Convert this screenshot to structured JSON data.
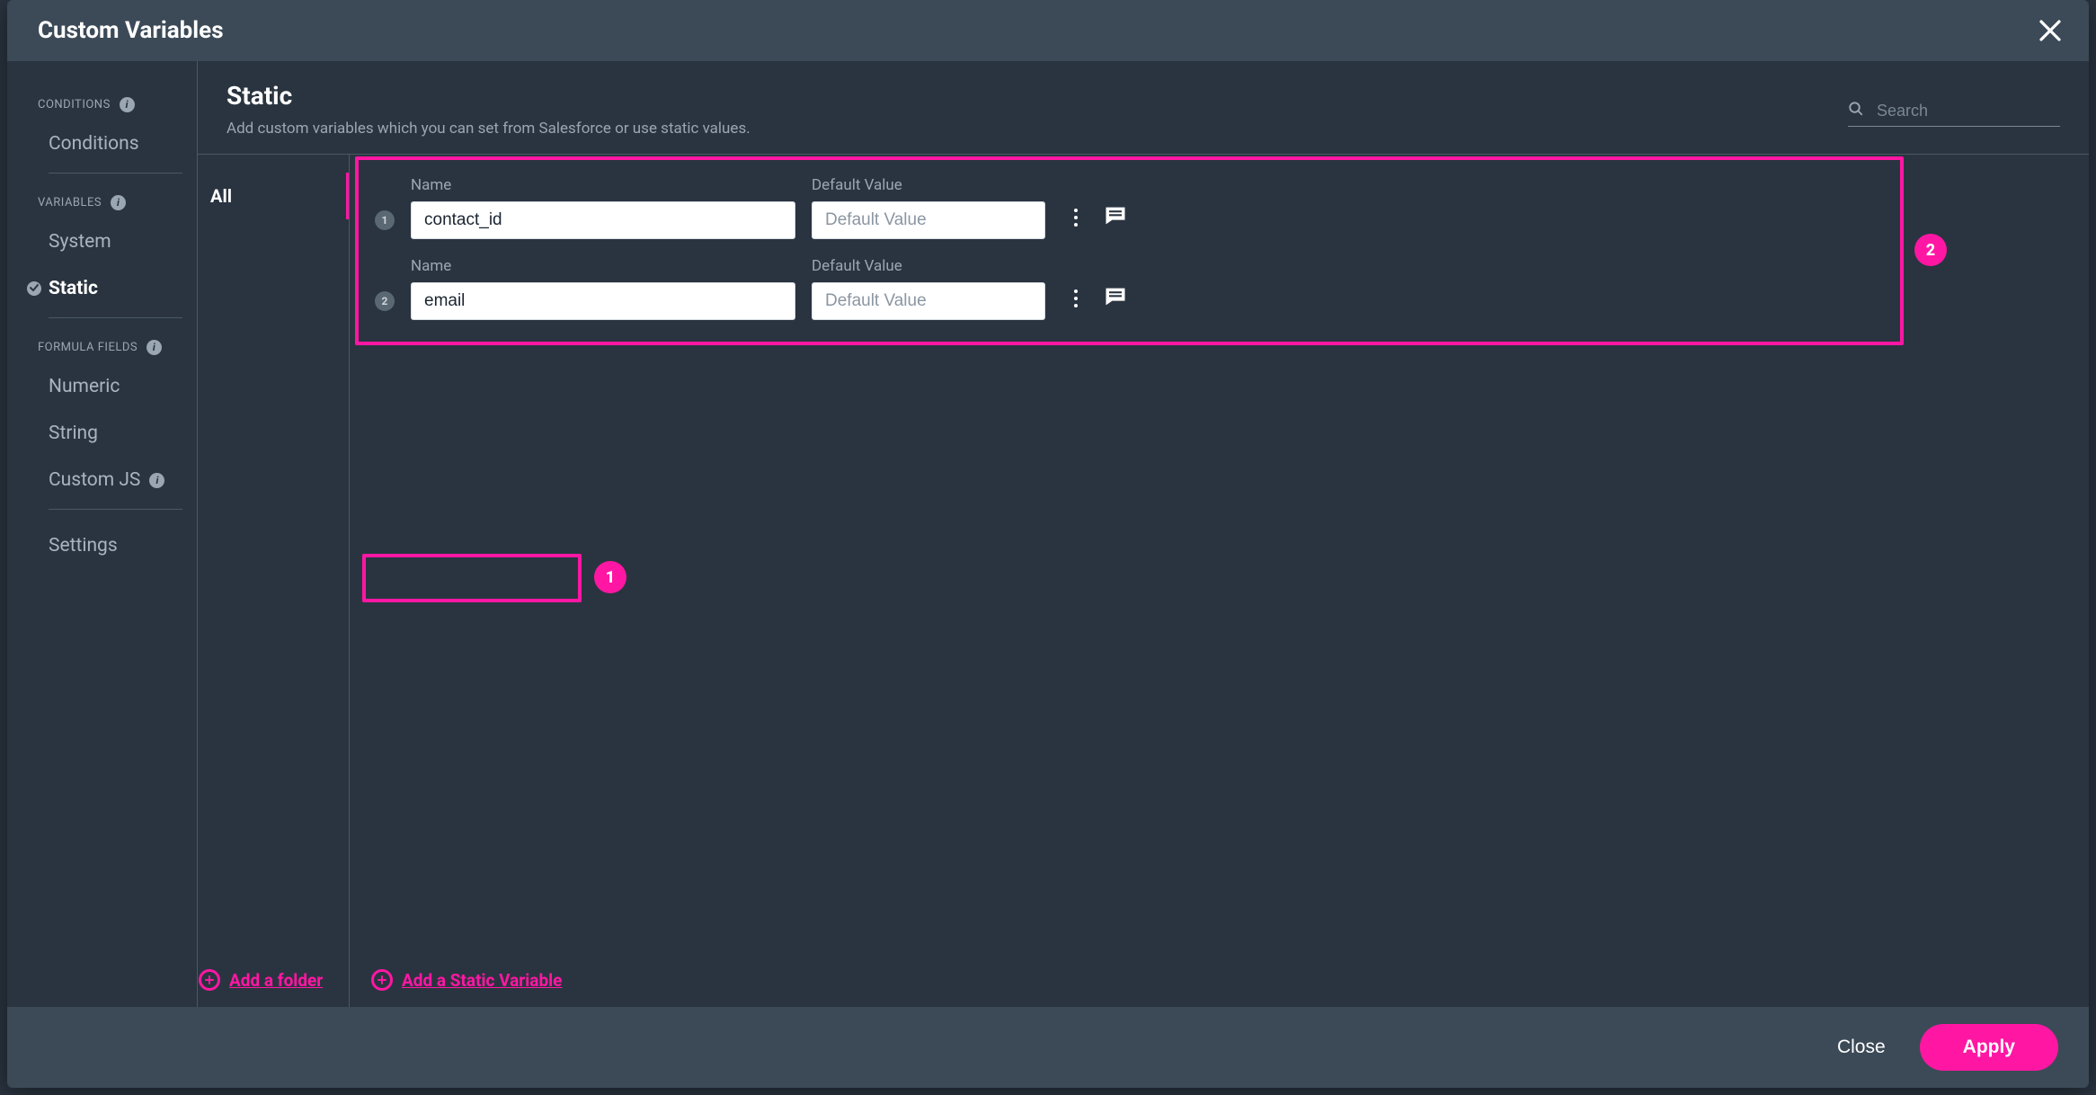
{
  "header": {
    "title": "Custom Variables"
  },
  "sidebar": {
    "sections": [
      {
        "title": "CONDITIONS",
        "has_info": true
      },
      {
        "title": "VARIABLES",
        "has_info": true
      },
      {
        "title": "FORMULA FIELDS",
        "has_info": true
      }
    ],
    "items": {
      "conditions": "Conditions",
      "system": "System",
      "static": "Static",
      "numeric": "Numeric",
      "string": "String",
      "customjs": "Custom JS",
      "settings": "Settings"
    },
    "active": "static"
  },
  "main": {
    "title": "Static",
    "subtitle": "Add custom variables which you can set from Salesforce or use static values.",
    "search_placeholder": "Search",
    "folder_tab": "All",
    "name_label": "Name",
    "default_label": "Default Value",
    "default_placeholder": "Default Value",
    "rows": [
      {
        "num": "1",
        "name": "contact_id",
        "default": ""
      },
      {
        "num": "2",
        "name": "email",
        "default": ""
      }
    ],
    "add_folder": "Add a folder",
    "add_variable": "Add a Static Variable",
    "callouts": {
      "rows": "2",
      "add": "1"
    }
  },
  "footer": {
    "close": "Close",
    "apply": "Apply"
  }
}
